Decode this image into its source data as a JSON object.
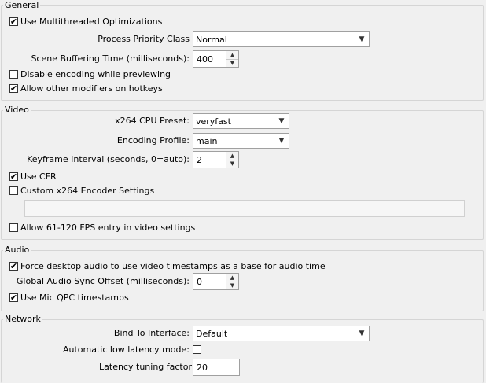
{
  "general": {
    "title": "General",
    "multithreaded": {
      "label": "Use Multithreaded Optimizations",
      "checked": true
    },
    "priority_label": "Process Priority Class",
    "priority_value": "Normal",
    "buffering_label": "Scene Buffering Time (milliseconds):",
    "buffering_value": "400",
    "disable_preview": {
      "label": "Disable encoding while previewing",
      "checked": false
    },
    "allow_modifiers": {
      "label": "Allow other modifiers on hotkeys",
      "checked": true
    }
  },
  "video": {
    "title": "Video",
    "cpu_preset_label": "x264 CPU Preset:",
    "cpu_preset_value": "veryfast",
    "profile_label": "Encoding Profile:",
    "profile_value": "main",
    "keyframe_label": "Keyframe Interval (seconds, 0=auto):",
    "keyframe_value": "2",
    "use_cfr": {
      "label": "Use CFR",
      "checked": true
    },
    "custom_x264": {
      "label": "Custom x264 Encoder Settings",
      "checked": false
    },
    "custom_x264_value": "",
    "allow_fps": {
      "label": "Allow 61-120 FPS entry in video settings",
      "checked": false
    }
  },
  "audio": {
    "title": "Audio",
    "force_desktop": {
      "label": "Force desktop audio to use video timestamps as a base for audio time",
      "checked": true
    },
    "sync_offset_label": "Global Audio Sync Offset (milliseconds):",
    "sync_offset_value": "0",
    "mic_qpc": {
      "label": "Use Mic QPC timestamps",
      "checked": true
    }
  },
  "network": {
    "title": "Network",
    "bind_label": "Bind To Interface:",
    "bind_value": "Default",
    "low_latency_label": "Automatic low latency mode:",
    "low_latency_checked": false,
    "latency_factor_label": "Latency tuning factor",
    "latency_factor_value": "20"
  },
  "icons": {
    "check": "✔",
    "down_arrow": "▼",
    "spin_up": "▲",
    "spin_down": "▼"
  }
}
